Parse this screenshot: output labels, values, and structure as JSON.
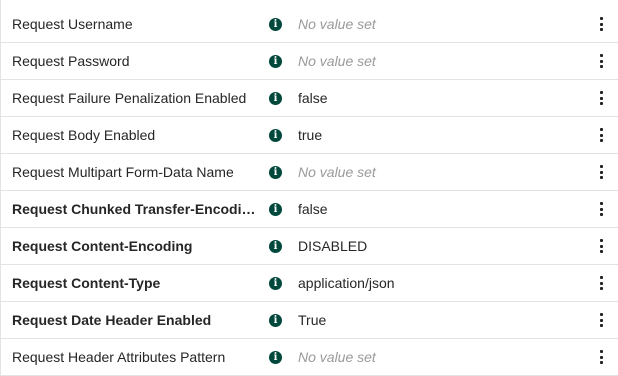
{
  "properties": [
    {
      "name": "Request Username",
      "value": "No value set",
      "empty": true,
      "bold": false
    },
    {
      "name": "Request Password",
      "value": "No value set",
      "empty": true,
      "bold": false
    },
    {
      "name": "Request Failure Penalization Enabled",
      "value": "false",
      "empty": false,
      "bold": false
    },
    {
      "name": "Request Body Enabled",
      "value": "true",
      "empty": false,
      "bold": false
    },
    {
      "name": "Request Multipart Form-Data Name",
      "value": "No value set",
      "empty": true,
      "bold": false
    },
    {
      "name": "Request Chunked Transfer-Encoding E...",
      "value": "false",
      "empty": false,
      "bold": true
    },
    {
      "name": "Request Content-Encoding",
      "value": "DISABLED",
      "empty": false,
      "bold": true
    },
    {
      "name": "Request Content-Type",
      "value": "application/json",
      "empty": false,
      "bold": true
    },
    {
      "name": "Request Date Header Enabled",
      "value": "True",
      "empty": false,
      "bold": true
    },
    {
      "name": "Request Header Attributes Pattern",
      "value": "No value set",
      "empty": true,
      "bold": false
    }
  ],
  "icons": {
    "info": "info-icon",
    "menu": "kebab-menu-icon",
    "info_glyph": "i"
  },
  "colors": {
    "info_icon": "#00473c",
    "empty_value": "#9a9a9a",
    "text": "#262626",
    "divider": "#e3e3e3"
  }
}
